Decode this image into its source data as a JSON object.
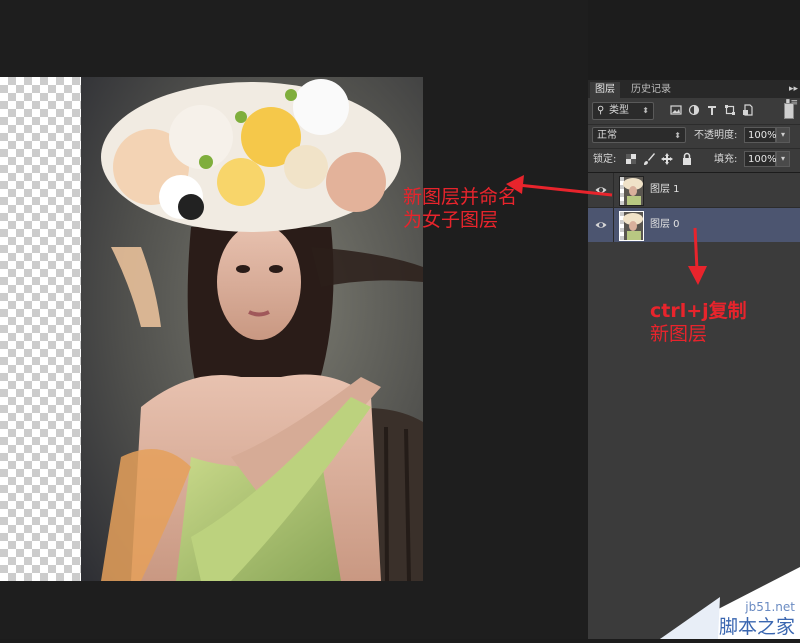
{
  "annotations": {
    "rename_note_line1": "新图层并命名",
    "rename_note_line2": "为女子图层",
    "copy_note_line1": "ctrl+j复制",
    "copy_note_line2": "新图层"
  },
  "layers_panel": {
    "tabs": [
      {
        "label": "图层",
        "active": true
      },
      {
        "label": "历史记录",
        "active": false
      }
    ],
    "filter_kind": "类型",
    "blend_mode": "正常",
    "opacity_label": "不透明度:",
    "opacity_value": "100%",
    "lock_label": "锁定:",
    "fill_label": "填充:",
    "fill_value": "100%",
    "layers": [
      {
        "name": "图层 1",
        "visible": true,
        "selected": false
      },
      {
        "name": "图层 0",
        "visible": true,
        "selected": true
      }
    ]
  },
  "watermark": {
    "site": "jb51.net",
    "name": "脚本之家"
  },
  "colors": {
    "annotation_red": "#e8242c",
    "selected_layer": "#4c5570",
    "panel_bg": "#3b3b3b"
  }
}
